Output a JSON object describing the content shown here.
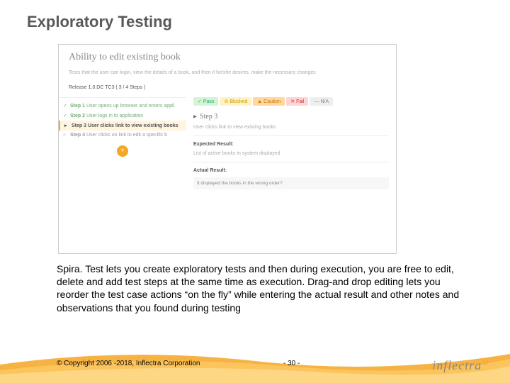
{
  "title": "Exploratory Testing",
  "screenshot": {
    "pageTitle": "Ability to edit existing book",
    "desc": "Tests that the user can login, view the details of a book, and then if he/she desires, make the necessary changes",
    "release": "Release 1.0.DC  TC3  ( 3 / 4 Steps )",
    "steps": [
      {
        "n": "Step 1",
        "t": "User opens up browser and enters appli",
        "cls": "done",
        "ico": "✓"
      },
      {
        "n": "Step 2",
        "t": "User logs in to application",
        "cls": "done",
        "ico": "✓"
      },
      {
        "n": "Step 3",
        "t": "User clicks link to view existing books",
        "cls": "active",
        "ico": "▸"
      },
      {
        "n": "Step 4",
        "t": "User clicks on link to edit a specific b",
        "cls": "",
        "ico": "○"
      }
    ],
    "status": {
      "pass": "Pass",
      "blocked": "Blocked",
      "caution": "Caution",
      "fail": "Fail",
      "na": "N/A"
    },
    "detail": {
      "stepTitle": "Step 3",
      "stepDesc": "User clicks link to view existing books",
      "expLabel": "Expected Result:",
      "expVal": "List of active books in system displayed",
      "actLabel": "Actual Result:",
      "actVal": "It displayed the books in the wrong order?"
    }
  },
  "bodyText": "Spira. Test lets you create exploratory tests and then during execution, you are free to edit, delete and add test steps at the same time as execution. Drag-and drop editing lets you reorder the test case actions “on the fly” while entering the actual result and other notes and observations that you found during testing",
  "copyright": "© Copyright 2006 -2018, Inflectra Corporation",
  "pageNum": "- 30 -",
  "logo": "inflectra"
}
